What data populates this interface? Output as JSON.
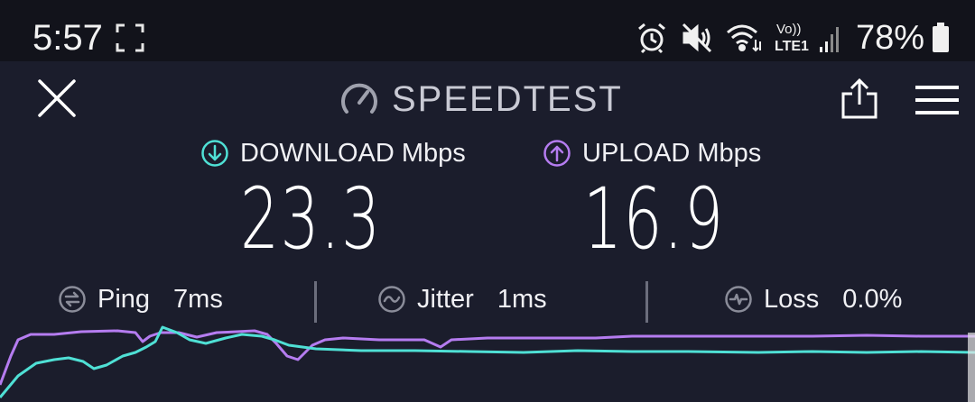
{
  "status_bar": {
    "time": "5:57",
    "battery_percent": "78%",
    "network": "LTE1",
    "volte": "Vo))"
  },
  "header": {
    "title": "SPEEDTEST"
  },
  "metrics": {
    "download": {
      "label": "DOWNLOAD Mbps",
      "value": "23.3",
      "color": "#4fe0d5"
    },
    "upload": {
      "label": "UPLOAD Mbps",
      "value": "16.9",
      "color": "#b57cf0"
    }
  },
  "stats": {
    "ping": {
      "label": "Ping",
      "value": "7ms"
    },
    "jitter": {
      "label": "Jitter",
      "value": "1ms"
    },
    "loss": {
      "label": "Loss",
      "value": "0.0%"
    }
  }
}
